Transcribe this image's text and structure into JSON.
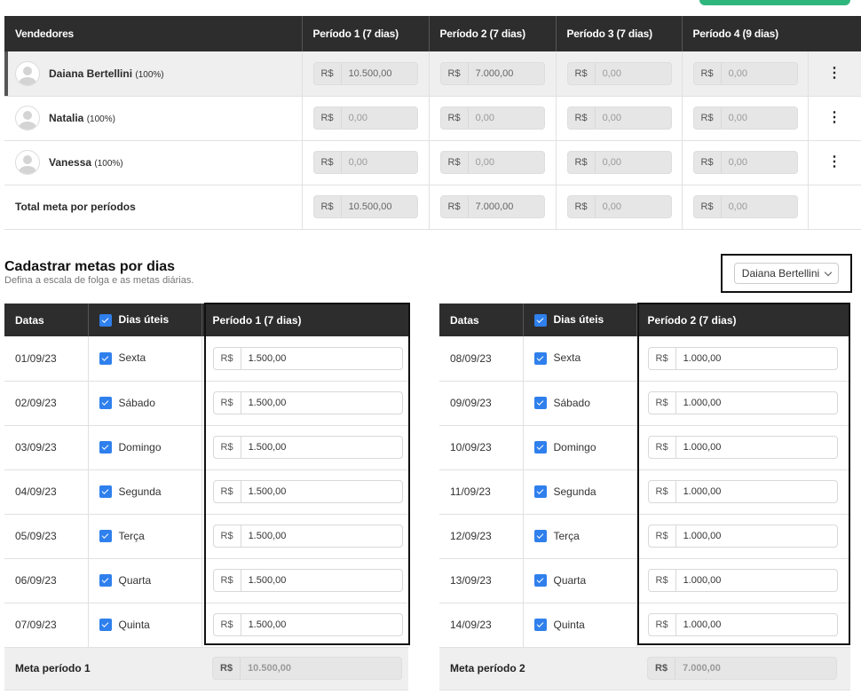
{
  "sellers_table": {
    "headers": [
      "Vendedores",
      "Período 1 (7 dias)",
      "Período 2 (7 dias)",
      "Período 3 (7 dias)",
      "Período 4 (9 dias)"
    ],
    "rows": [
      {
        "name": "Daiana Bertellini",
        "pct": "(100%)",
        "values": [
          "10.500,00",
          "7.000,00",
          "0,00",
          "0,00"
        ]
      },
      {
        "name": "Natalia",
        "pct": "(100%)",
        "values": [
          "0,00",
          "0,00",
          "0,00",
          "0,00"
        ]
      },
      {
        "name": "Vanessa",
        "pct": "(100%)",
        "values": [
          "0,00",
          "0,00",
          "0,00",
          "0,00"
        ]
      }
    ],
    "total_label": "Total meta por períodos",
    "totals": [
      "10.500,00",
      "7.000,00",
      "0,00",
      "0,00"
    ],
    "currency": "R$",
    "menu_glyph": "⋮"
  },
  "daily_section": {
    "title": "Cadastrar metas por dias",
    "subtitle": "Defina a escala de folga e as metas diárias.",
    "seller_select": "Daiana Bertellini"
  },
  "period_tables": [
    {
      "headers": [
        "Datas",
        "Dias úteis",
        "Período 1 (7 dias)"
      ],
      "rows": [
        {
          "date": "01/09/23",
          "day": "Sexta",
          "value": "1.500,00"
        },
        {
          "date": "02/09/23",
          "day": "Sábado",
          "value": "1.500,00"
        },
        {
          "date": "03/09/23",
          "day": "Domingo",
          "value": "1.500,00"
        },
        {
          "date": "04/09/23",
          "day": "Segunda",
          "value": "1.500,00"
        },
        {
          "date": "05/09/23",
          "day": "Terça",
          "value": "1.500,00"
        },
        {
          "date": "06/09/23",
          "day": "Quarta",
          "value": "1.500,00"
        },
        {
          "date": "07/09/23",
          "day": "Quinta",
          "value": "1.500,00"
        }
      ],
      "footer_label": "Meta período 1",
      "footer_value": "10.500,00"
    },
    {
      "headers": [
        "Datas",
        "Dias úteis",
        "Período 2 (7 dias)"
      ],
      "rows": [
        {
          "date": "08/09/23",
          "day": "Sexta",
          "value": "1.000,00"
        },
        {
          "date": "09/09/23",
          "day": "Sábado",
          "value": "1.000,00"
        },
        {
          "date": "10/09/23",
          "day": "Domingo",
          "value": "1.000,00"
        },
        {
          "date": "11/09/23",
          "day": "Segunda",
          "value": "1.000,00"
        },
        {
          "date": "12/09/23",
          "day": "Terça",
          "value": "1.000,00"
        },
        {
          "date": "13/09/23",
          "day": "Quarta",
          "value": "1.000,00"
        },
        {
          "date": "14/09/23",
          "day": "Quinta",
          "value": "1.000,00"
        }
      ],
      "footer_label": "Meta período 2",
      "footer_value": "7.000,00"
    }
  ],
  "colors": {
    "header_bg": "#2d2d2d",
    "checkbox": "#2f80ed",
    "top_button": "#2fb67c"
  }
}
